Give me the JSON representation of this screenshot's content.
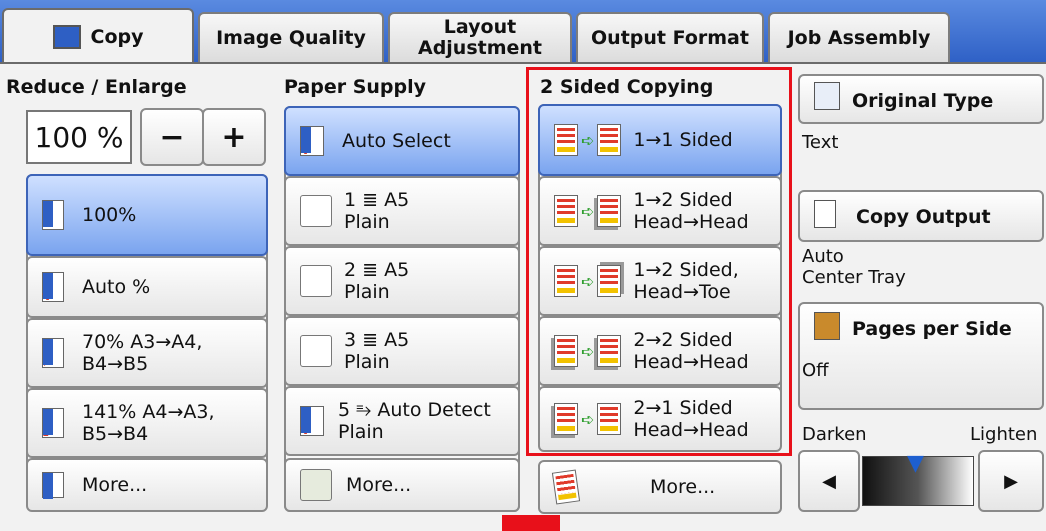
{
  "tabs": [
    {
      "label": "Copy",
      "active": true
    },
    {
      "label": "Image Quality"
    },
    {
      "label": "Layout\nAdjustment"
    },
    {
      "label": "Output Format"
    },
    {
      "label": "Job Assembly"
    }
  ],
  "reduce_enlarge": {
    "title": "Reduce / Enlarge",
    "value": "100 %",
    "minus": "−",
    "plus": "+",
    "options": [
      {
        "label": "100%",
        "icon": "document-icon",
        "selected": true
      },
      {
        "label": "Auto %",
        "icon": "auto-reduce-icon"
      },
      {
        "label": "70% A3→A4,\nB4→B5",
        "icon": "reduce-icon"
      },
      {
        "label": "141% A4→A3,\nB5→B4",
        "icon": "enlarge-icon"
      },
      {
        "label": "More...",
        "icon": "more-icon"
      }
    ]
  },
  "paper_supply": {
    "title": "Paper Supply",
    "options": [
      {
        "label": "Auto Select",
        "selected": true
      },
      {
        "label": "1 ≣ A5\nPlain"
      },
      {
        "label": "2 ≣ A5\nPlain"
      },
      {
        "label": "3 ≣ A5\nPlain"
      },
      {
        "label": "5 ⥱ Auto Detect\nPlain"
      },
      {
        "label": "More..."
      }
    ]
  },
  "two_sided": {
    "title": "2 Sided Copying",
    "options": [
      {
        "label": "1→1 Sided",
        "selected": true
      },
      {
        "label": "1→2 Sided\nHead→Head"
      },
      {
        "label": "1→2 Sided,\nHead→Toe"
      },
      {
        "label": "2→2 Sided\nHead→Head"
      },
      {
        "label": "2→1 Sided\nHead→Head"
      },
      {
        "label": "More..."
      }
    ]
  },
  "side_panel": {
    "original_type": {
      "title": "Original Type",
      "value": "Text"
    },
    "copy_output": {
      "title": "Copy Output",
      "value": "Auto\nCenter Tray"
    },
    "pages_per_side": {
      "title": "Pages per Side",
      "value": "Off"
    },
    "darken_label": "Darken",
    "lighten_label": "Lighten",
    "left_arrow": "◀",
    "right_arrow": "▶"
  },
  "colors": {
    "tab_bar": "#2f61c6",
    "selected_button": "#7aa4ef",
    "highlight_box": "#e8101a"
  }
}
